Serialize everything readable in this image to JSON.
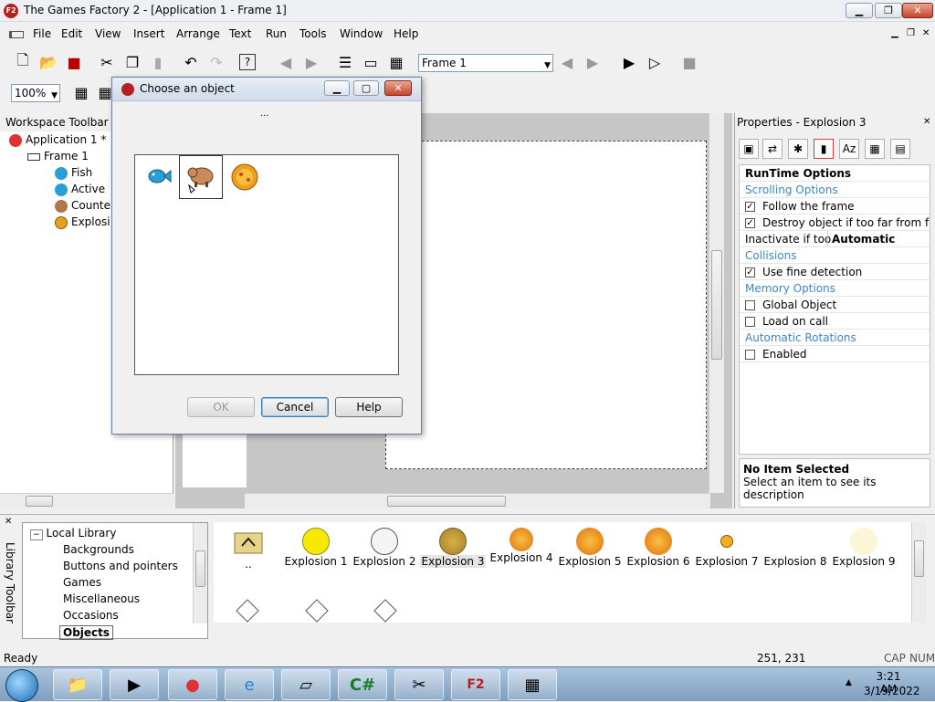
{
  "window": {
    "title": "The Games Factory 2 - [Application 1 - Frame 1]",
    "app_icon_label": "F2",
    "minimize": "▁",
    "restore": "❐",
    "close": "✕"
  },
  "menu": {
    "items": [
      {
        "label": "File"
      },
      {
        "label": "Edit"
      },
      {
        "label": "View"
      },
      {
        "label": "Insert"
      },
      {
        "label": "Arrange"
      },
      {
        "label": "Text"
      },
      {
        "label": "Run"
      },
      {
        "label": "Tools"
      },
      {
        "label": "Window"
      },
      {
        "label": "Help"
      }
    ],
    "mdi_controls": [
      "▁",
      "❐",
      "✕"
    ]
  },
  "toolbar": {
    "frame_select": "Frame 1",
    "zoom": "100%"
  },
  "workspace": {
    "title": "Workspace Toolbar",
    "tree": [
      {
        "label": "Application 1 *"
      },
      {
        "label": "Frame 1"
      },
      {
        "label": "Fish"
      },
      {
        "label": "Active"
      },
      {
        "label": "Counte"
      },
      {
        "label": "Explosi"
      }
    ]
  },
  "dialog": {
    "title": "Choose an object",
    "path_text": "...",
    "ok": "OK",
    "cancel": "Cancel",
    "help": "Help"
  },
  "properties": {
    "title": "Properties - Explosion 3",
    "rows": {
      "runtime": "RunTime Options",
      "scrolling": "Scrolling Options",
      "follow": "Follow the frame",
      "destroy": "Destroy object if too far from fra",
      "inactivate": "Inactivate if too",
      "inactivate_value": "Automatic",
      "collisions": "Collisions",
      "fine": "Use fine detection",
      "memory": "Memory Options",
      "global": "Global Object",
      "load": "Load on call",
      "rotations": "Automatic Rotations",
      "enabled": "Enabled"
    },
    "desc_title": "No Item Selected",
    "desc_text": "Select an item to see its description"
  },
  "library": {
    "title": "Library Toolbar",
    "tree": [
      {
        "label": "Local Library"
      },
      {
        "label": "Backgrounds"
      },
      {
        "label": "Buttons and pointers"
      },
      {
        "label": "Games"
      },
      {
        "label": "Miscellaneous"
      },
      {
        "label": "Occasions"
      },
      {
        "label": "Objects"
      }
    ],
    "items": [
      {
        "label": ".."
      },
      {
        "label": "Explosion 1"
      },
      {
        "label": "Explosion 2"
      },
      {
        "label": "Explosion 3"
      },
      {
        "label": "Explosion 4"
      },
      {
        "label": "Explosion 5"
      },
      {
        "label": "Explosion 6"
      },
      {
        "label": "Explosion 7"
      },
      {
        "label": "Explosion 8"
      },
      {
        "label": "Explosion 9"
      }
    ]
  },
  "status": {
    "text": "Ready",
    "coords": "251, 231",
    "cap": "CAP",
    "num": "NUM"
  },
  "taskbar": {
    "time": "3:21 AM",
    "date": "3/19/2022"
  },
  "colors": {
    "section_blue": "#3c86c8",
    "explosion_orange": "#e8a020",
    "fish_blue": "#2a9fd6"
  }
}
